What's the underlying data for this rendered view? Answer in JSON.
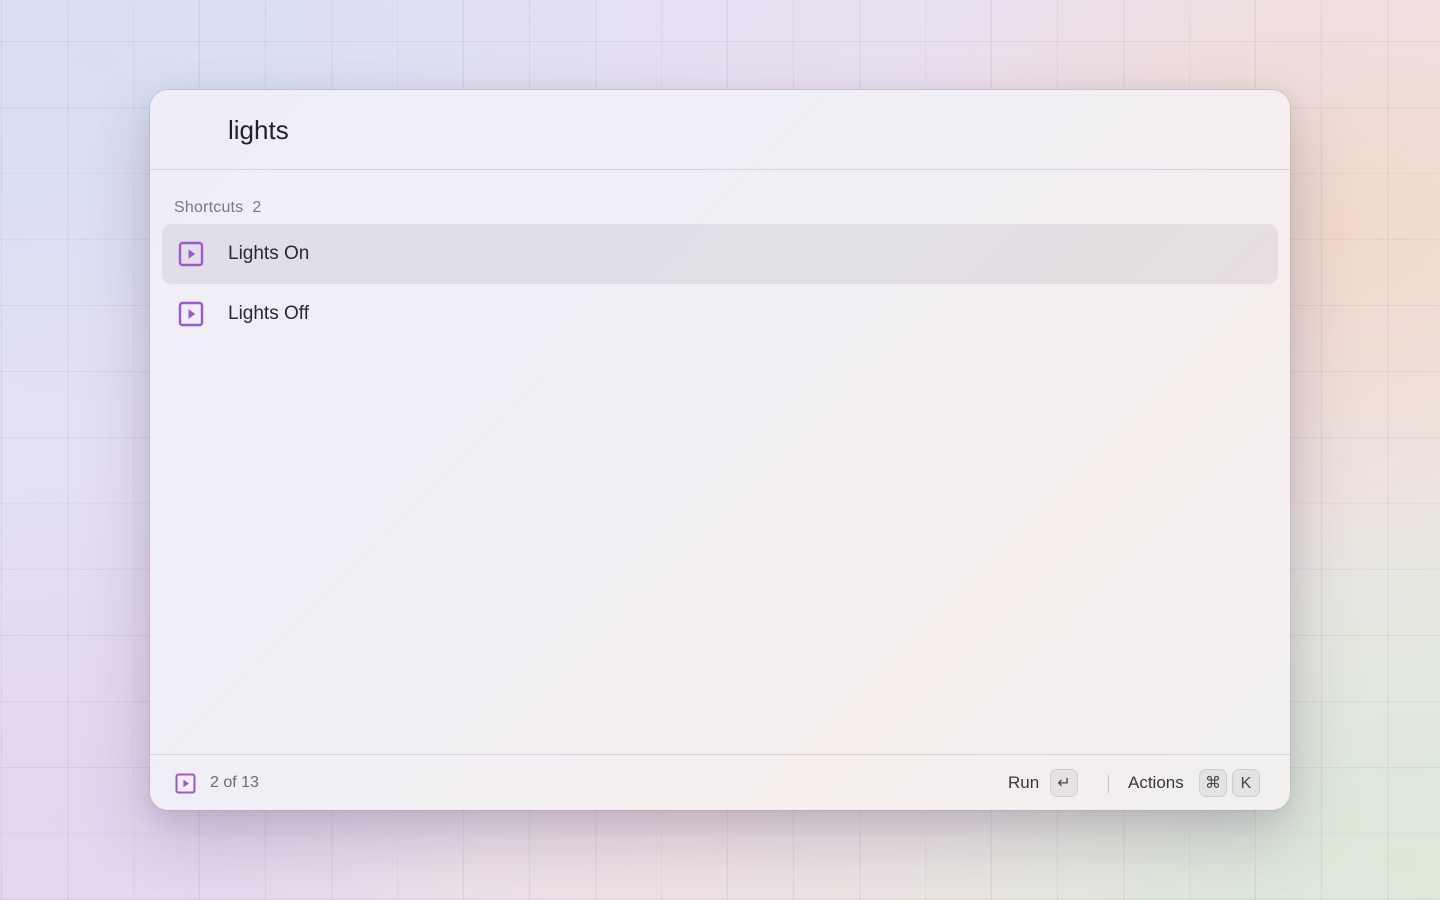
{
  "search": {
    "value": "lights"
  },
  "section": {
    "title": "Shortcuts",
    "count": "2"
  },
  "items": [
    {
      "label": "Lights On",
      "icon": "play-square-icon",
      "selected": true
    },
    {
      "label": "Lights Off",
      "icon": "play-square-icon",
      "selected": false
    }
  ],
  "footer": {
    "icon": "play-square-icon",
    "position": "2 of 13",
    "primary_action": "Run",
    "primary_key": "↵",
    "secondary_action": "Actions",
    "secondary_keys": [
      "⌘",
      "K"
    ]
  },
  "colors": {
    "accent": "#9b59d0",
    "selected_row": "#e3dfe6",
    "text": "#2a2830",
    "muted_text": "#7c7783"
  }
}
